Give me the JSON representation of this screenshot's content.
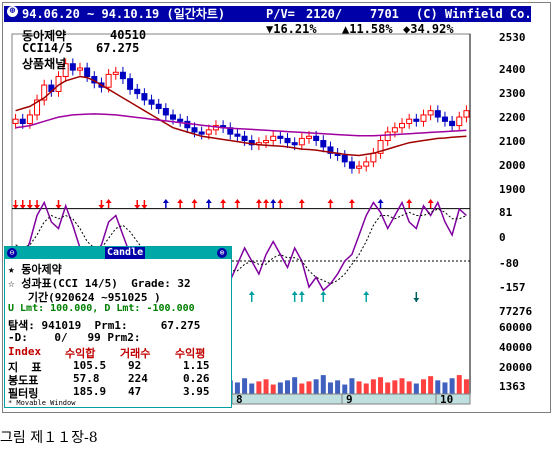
{
  "titlebar": {
    "system_icon": "window-system-icon",
    "date_range": "94.06.20 ~ 94.10.19 (일간차트)",
    "pv_label": "P/V=",
    "pv_value": "2120/",
    "volume": "7701",
    "copyright": "(C) Winfield Co."
  },
  "stats_line": {
    "down_pct": "▼16.21%",
    "up_pct": "▲11.58%",
    "net_pct": "◆34.92%"
  },
  "info": {
    "stock_name": "동아제약",
    "stock_value": "40510",
    "indicator": "CCI14/5",
    "indicator_value": "67.275",
    "channel": "상품채널"
  },
  "chart_data": [
    {
      "type": "candlestick",
      "title": "",
      "ylim": [
        1800,
        2550
      ],
      "y_ticks": [
        "2530",
        "2400",
        "2300",
        "2200",
        "2100",
        "2000",
        "1900"
      ],
      "series": [
        {
          "kind": "ohlc",
          "color_up": "#ff0000",
          "color_down": "#0000c0"
        },
        {
          "kind": "moving-average",
          "color": "#a00000"
        },
        {
          "kind": "moving-average",
          "color": "#a000a0"
        }
      ],
      "closes": [
        2160,
        2140,
        2180,
        2250,
        2320,
        2290,
        2360,
        2420,
        2390,
        2400,
        2360,
        2330,
        2310,
        2370,
        2380,
        2350,
        2300,
        2280,
        2250,
        2230,
        2210,
        2180,
        2160,
        2150,
        2120,
        2100,
        2090,
        2110,
        2130,
        2120,
        2090,
        2080,
        2060,
        2040,
        2050,
        2060,
        2080,
        2070,
        2050,
        2040,
        2070,
        2080,
        2060,
        2030,
        2000,
        1990,
        1960,
        1930,
        1940,
        1960,
        2000,
        2060,
        2100,
        2120,
        2140,
        2160,
        2150,
        2180,
        2200,
        2170,
        2150,
        2130,
        2170,
        2200
      ],
      "ma_short": [
        2200,
        2210,
        2220,
        2240,
        2260,
        2290,
        2320,
        2340,
        2350,
        2360,
        2355,
        2340,
        2320,
        2300,
        2280,
        2260,
        2240,
        2220,
        2200,
        2180,
        2160,
        2140,
        2120,
        2110,
        2100,
        2090,
        2080,
        2075,
        2070,
        2065,
        2060,
        2055,
        2050,
        2045,
        2040,
        2038,
        2036,
        2034,
        2030,
        2025,
        2020,
        2018,
        2015,
        2010,
        2005,
        2000,
        1995,
        1992,
        1990,
        1995,
        2000,
        2010,
        2020,
        2030,
        2040,
        2050,
        2055,
        2060,
        2065,
        2070,
        2072,
        2075,
        2078,
        2080
      ],
      "ma_long": [
        2120,
        2125,
        2130,
        2140,
        2150,
        2160,
        2170,
        2175,
        2180,
        2182,
        2184,
        2185,
        2184,
        2182,
        2180,
        2176,
        2172,
        2168,
        2164,
        2160,
        2156,
        2152,
        2148,
        2144,
        2140,
        2136,
        2132,
        2128,
        2124,
        2120,
        2118,
        2116,
        2114,
        2112,
        2110,
        2108,
        2106,
        2104,
        2102,
        2100,
        2098,
        2096,
        2094,
        2092,
        2090,
        2088,
        2086,
        2084,
        2082,
        2082,
        2082,
        2084,
        2086,
        2088,
        2090,
        2092,
        2094,
        2096,
        2098,
        2100,
        2102,
        2104,
        2106,
        2108
      ]
    },
    {
      "type": "line",
      "title": "CCI",
      "ylim": [
        -200,
        120
      ],
      "y_ticks": [
        "81",
        "0",
        "-80",
        "-157"
      ],
      "reference_lines": [
        81,
        -80
      ],
      "cci": [
        -40,
        -80,
        -20,
        60,
        100,
        40,
        20,
        90,
        30,
        -40,
        -90,
        -60,
        -30,
        40,
        60,
        0,
        -60,
        -80,
        -90,
        -110,
        -140,
        -100,
        -130,
        -160,
        -90,
        -40,
        -60,
        -100,
        -70,
        -110,
        -140,
        -90,
        -40,
        -80,
        -120,
        -60,
        -20,
        -60,
        -100,
        -40,
        -80,
        -160,
        -130,
        -170,
        -150,
        -120,
        -80,
        -60,
        0,
        60,
        100,
        70,
        20,
        60,
        100,
        40,
        20,
        90,
        60,
        100,
        40,
        0,
        80,
        60
      ],
      "signal": [
        -30,
        -40,
        -30,
        0,
        40,
        60,
        50,
        60,
        50,
        20,
        -20,
        -40,
        -40,
        -10,
        20,
        30,
        10,
        -20,
        -50,
        -80,
        -100,
        -110,
        -115,
        -130,
        -120,
        -90,
        -70,
        -70,
        -80,
        -90,
        -110,
        -110,
        -90,
        -80,
        -90,
        -90,
        -70,
        -60,
        -70,
        -70,
        -80,
        -110,
        -130,
        -140,
        -150,
        -140,
        -120,
        -90,
        -60,
        -20,
        30,
        60,
        60,
        50,
        60,
        70,
        60,
        60,
        70,
        80,
        70,
        50,
        50,
        60
      ]
    },
    {
      "type": "bar",
      "title": "Volume",
      "ylim": [
        0,
        80000
      ],
      "y_ticks": [
        "77276",
        "60000",
        "40000",
        "20000",
        "1363"
      ],
      "x_labels": [
        "8",
        "9",
        "10"
      ],
      "values": [
        22000,
        15000,
        18000,
        20000,
        12000,
        14000,
        16000,
        25000,
        9000,
        11000,
        13000,
        17000,
        10000,
        8000,
        15000,
        12000,
        9000,
        14000,
        11000,
        16000,
        13000,
        10000,
        12000,
        15000,
        9000,
        11000,
        14000,
        10000,
        12000,
        9000,
        13000,
        11000,
        15000,
        10000,
        12000,
        14000,
        9000,
        11000,
        13000,
        16000,
        10000,
        12000,
        14000,
        18000,
        11000,
        13000,
        9000,
        15000,
        12000,
        10000,
        14000,
        16000,
        11000,
        13000,
        15000,
        12000,
        10000,
        14000,
        17000,
        13000,
        11000,
        15000,
        18000,
        14000
      ]
    }
  ],
  "signals": {
    "buy_arrow_color": "#ff0000",
    "sell_arrow_color": "#0000c0",
    "cci_arrow_up_color": "#00a0a0"
  },
  "panel": {
    "title": "Candle",
    "line1": "★ 동아제약",
    "line2": "☆ 성과표(CCI 14/5)  Grade: 32",
    "line3": "   기간(920624 ~951025 )",
    "limits": "U Lmt: 100.000, D Lmt: -100.000",
    "search": "탐색: 941019  Prm1:     67.275",
    "d_row": "-D:    0/   99 Prm2:",
    "table_headers": [
      "Index",
      "수익합",
      "거래수",
      "수익평"
    ],
    "table_rows": [
      [
        "지  표",
        "105.5",
        "92",
        "1.15"
      ],
      [
        "봉도표",
        "57.8",
        "224",
        "0.26"
      ],
      [
        "필터링",
        "185.9",
        "47",
        "3.95"
      ]
    ],
    "footer": "* Movable Window"
  },
  "caption": "그림 제１１장-8"
}
